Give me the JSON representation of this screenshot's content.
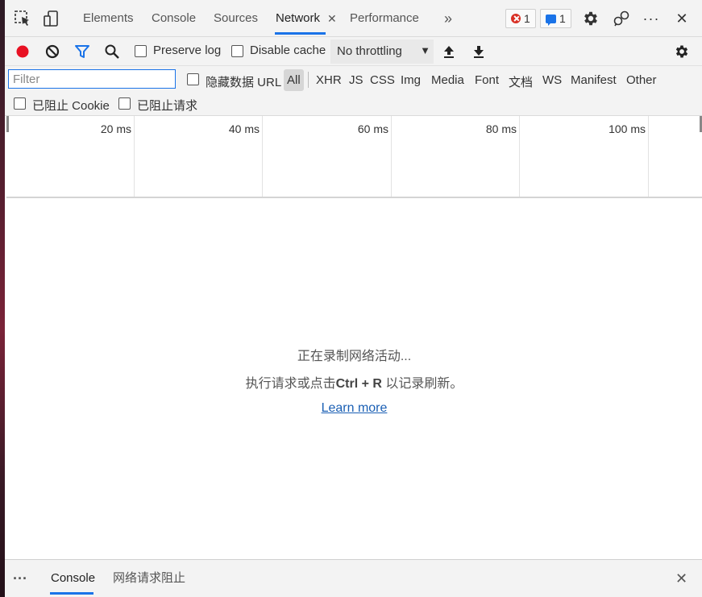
{
  "tabbar": {
    "tabs": [
      {
        "label": "Elements"
      },
      {
        "label": "Console"
      },
      {
        "label": "Sources"
      },
      {
        "label": "Network"
      },
      {
        "label": "Performance"
      }
    ],
    "active_tab": "Network",
    "more_tabs_glyph": "»",
    "error_count": "1",
    "message_count": "1",
    "more_menu_glyph": "···",
    "close_glyph": "✕",
    "icons": [
      "inspect-icon",
      "device-toggle-icon",
      "settings-gear-icon",
      "feedback-icon",
      "more-icon",
      "close-icon"
    ]
  },
  "toolbar": {
    "preserve_log_label": "Preserve log",
    "disable_cache_label": "Disable cache",
    "throttling_value": "No throttling",
    "colors": {
      "record": "#e81123",
      "filter": "#1a73e8"
    }
  },
  "filterbar": {
    "filter_placeholder": "Filter",
    "hide_data_urls_label": "隐藏数据 URL",
    "types": [
      "All",
      "XHR",
      "JS",
      "CSS",
      "Img",
      "Media",
      "Font",
      "文档",
      "WS",
      "Manifest",
      "Other"
    ],
    "active_type": "All",
    "blocked_cookies_label": "已阻止 Cookie",
    "blocked_requests_label": "已阻止请求"
  },
  "timeline": {
    "ticks": [
      "20 ms",
      "40 ms",
      "60 ms",
      "80 ms",
      "100 ms"
    ]
  },
  "main": {
    "line1": "正在录制网络活动...",
    "line2_prefix": "执行请求或点击",
    "line2_shortcut": "Ctrl + R",
    "line2_suffix": " 以记录刷新。",
    "learn_more": "Learn more"
  },
  "drawer": {
    "menu_glyph": "⋮",
    "tabs": [
      {
        "label": "Console"
      },
      {
        "label": "网络请求阻止"
      }
    ],
    "close_glyph": "✕"
  }
}
